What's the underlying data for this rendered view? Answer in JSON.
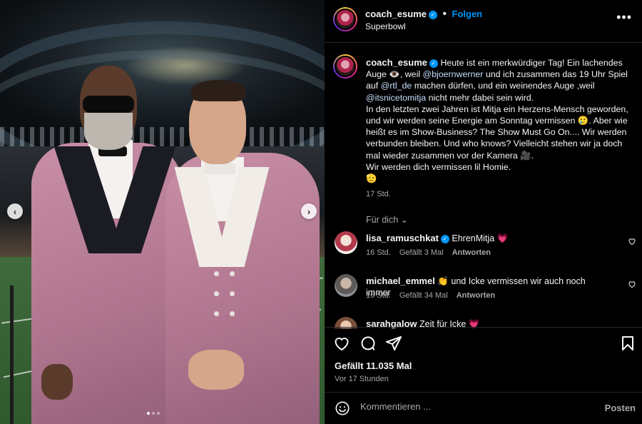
{
  "post": {
    "author": "coach_esume",
    "follow_label": "Folgen",
    "location": "Superbowl",
    "more_label": "•••"
  },
  "caption": {
    "author": "coach_esume",
    "t1": "Heute ist ein merkwürdiger Tag! Ein lachendes Auge",
    "t2": ", weil",
    "mention1": "@bjoernwerner",
    "t3": "und ich zusammen das 19 Uhr Spiel auf",
    "mention2": "@rtl_de",
    "t4": "machen dürfen, und ein weinendes Auge ,weil",
    "mention3": "@itsnicetomitja",
    "t5": "nicht mehr dabei sein wird.",
    "p2": "In den letzten zwei Jahren ist Mitja ein Herzens-Mensch geworden, und wir werden seine Energie am Sonntag vermissen",
    "p2b": ". Aber wie heißt es im Show-Business? The Show Must Go On.... Wir werden verbunden bleiben. Und who knows? Vielleicht stehen wir ja doch mal wieder zusammen vor der Kamera",
    "p2c": ".",
    "p3": "Wir werden dich vermissen lil Homie.",
    "time": "17 Std."
  },
  "for_you": "Für dich",
  "comments": [
    {
      "user": "lisa_ramuschkat",
      "text": "EhrenMitja",
      "time": "16 Std.",
      "likes": "Gefällt 3 Mal",
      "reply": "Antworten"
    },
    {
      "user": "michael_emmel",
      "text": "und Icke vermissen wir auch noch immer",
      "time": "16 Std.",
      "likes": "Gefällt 34 Mal",
      "reply": "Antworten"
    },
    {
      "user": "sarahgalow",
      "text": "Zeit für Icke"
    }
  ],
  "likes_label": "Gefällt 11.035 Mal",
  "ago": "Vor 17 Stunden",
  "comment_placeholder": "Kommentieren ...",
  "post_label": "Posten",
  "colors": {
    "link": "#0095f6",
    "bg": "#000000",
    "muted": "#a8a8a8"
  },
  "carousel": {
    "prev": "‹",
    "next": "›"
  }
}
